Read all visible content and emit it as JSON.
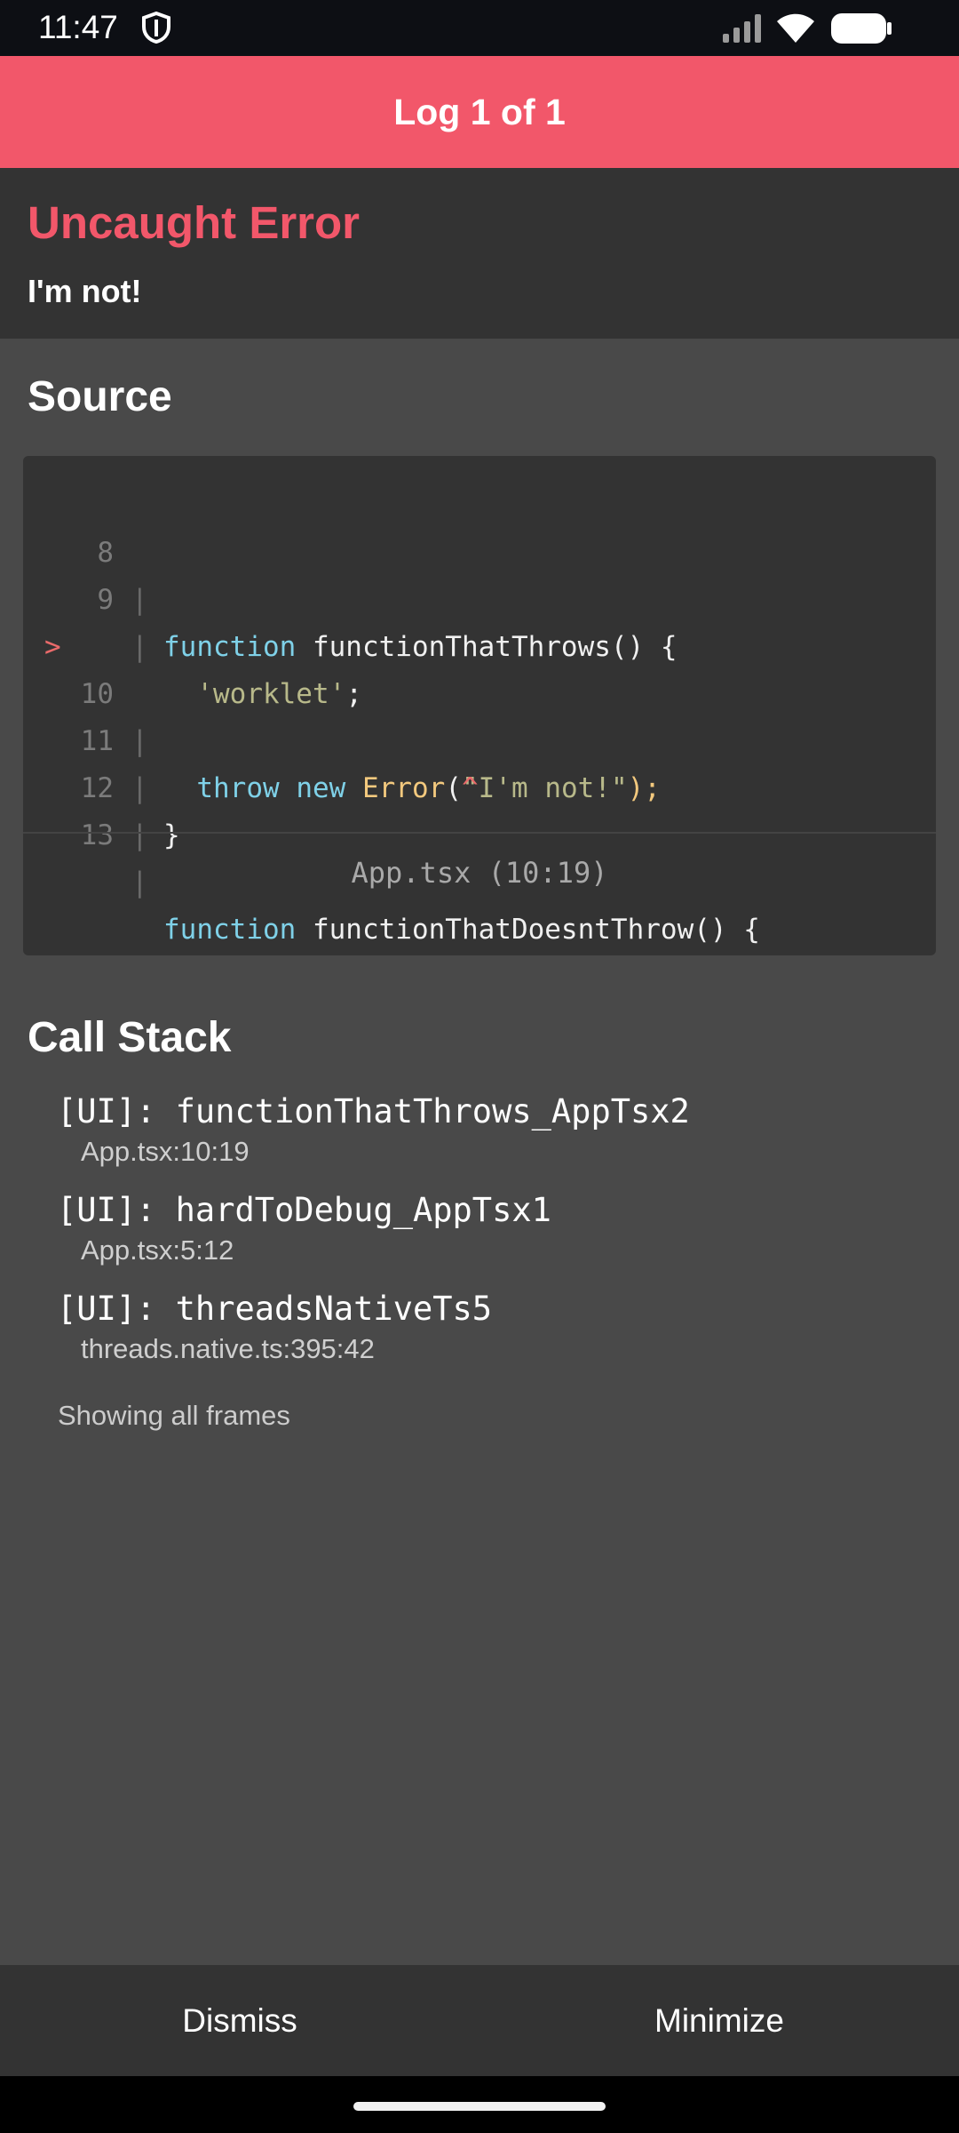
{
  "status_bar": {
    "time": "11:47",
    "icons": [
      "shield-icon",
      "signal-icon",
      "wifi-icon",
      "battery-icon"
    ]
  },
  "header": {
    "title": "Log 1 of 1"
  },
  "error": {
    "title": "Uncaught Error",
    "message": "I'm not!"
  },
  "source": {
    "heading": "Source",
    "lines": [
      {
        "num": "8",
        "marker": "",
        "code": "function functionThatThrows() {"
      },
      {
        "num": "9",
        "marker": "",
        "code": "  'worklet';"
      },
      {
        "num": "10",
        "marker": ">",
        "code": "  throw new Error(\"I'm not!\");"
      },
      {
        "num": "",
        "marker": "",
        "code": "                  ^"
      },
      {
        "num": "11",
        "marker": "",
        "code": "}"
      },
      {
        "num": "12",
        "marker": "",
        "code": ""
      },
      {
        "num": "13",
        "marker": "",
        "code": "function functionThatDoesntThrow() {"
      }
    ],
    "file_ref": "App.tsx (10:19)"
  },
  "call_stack": {
    "heading": "Call Stack",
    "frames": [
      {
        "name": "[UI]: functionThatThrows_AppTsx2",
        "location": "App.tsx:10:19"
      },
      {
        "name": "[UI]: hardToDebug_AppTsx1",
        "location": "App.tsx:5:12"
      },
      {
        "name": "[UI]: threadsNativeTs5",
        "location": "threads.native.ts:395:42"
      }
    ],
    "frames_toggle": "Showing all frames"
  },
  "footer": {
    "dismiss_label": "Dismiss",
    "minimize_label": "Minimize"
  },
  "colors": {
    "accent": "#f2576a",
    "background": "#494949",
    "panel": "#333333",
    "keyword": "#7fd1e8",
    "string": "#b8b98a",
    "function_name": "#f3c97e",
    "caret": "#e96a6a"
  }
}
